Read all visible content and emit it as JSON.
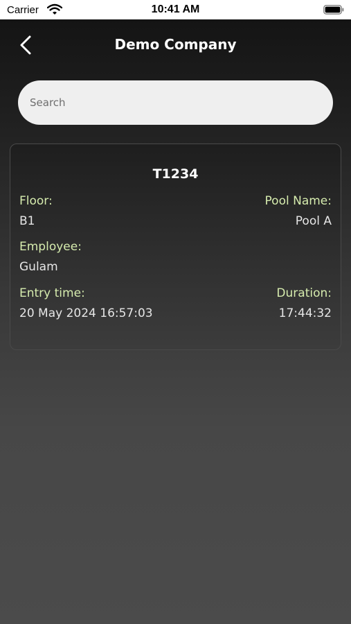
{
  "status_bar": {
    "carrier": "Carrier",
    "time": "10:41 AM"
  },
  "header": {
    "title": "Demo Company"
  },
  "search": {
    "placeholder": "Search",
    "value": ""
  },
  "ticket": {
    "id": "T1234",
    "floor_label": "Floor:",
    "floor_value": "B1",
    "pool_label": "Pool Name:",
    "pool_value": "Pool A",
    "employee_label": "Employee:",
    "employee_value": "Gulam",
    "entry_label": "Entry time:",
    "entry_value": "20 May 2024 16:57:03",
    "duration_label": "Duration:",
    "duration_value": "17:44:32"
  },
  "colors": {
    "label_accent": "#d6ecae",
    "search_background": "#efefef",
    "card_border": "#4a4a4a"
  },
  "icons": {
    "back": "chevron-left-icon",
    "wifi": "wifi-icon",
    "battery": "battery-icon"
  }
}
